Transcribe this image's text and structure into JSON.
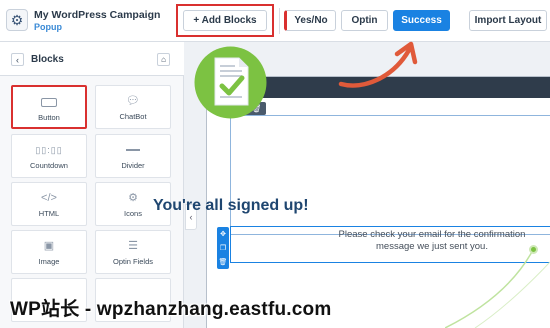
{
  "header": {
    "campaign_title": "My WordPress Campaign",
    "campaign_type": "Popup",
    "add_blocks_label": "+ Add Blocks",
    "tabs": [
      {
        "label": "Yes/No"
      },
      {
        "label": "Optin"
      },
      {
        "label": "Success",
        "active": true
      }
    ],
    "import_layout_label": "Import Layout",
    "accent_color": "#1a82e2",
    "highlight_color": "#d9302f"
  },
  "sidebar": {
    "title": "Blocks",
    "back_icon": "chevron-left-icon",
    "home_icon": "home-icon",
    "blocks": [
      {
        "label": "Button",
        "icon": "button-icon"
      },
      {
        "label": "ChatBot",
        "icon": "chat-icon"
      },
      {
        "label": "Countdown",
        "icon": "countdown-icon"
      },
      {
        "label": "Divider",
        "icon": "divider-icon"
      },
      {
        "label": "HTML",
        "icon": "code-icon"
      },
      {
        "label": "Icons",
        "icon": "gear-icon"
      },
      {
        "label": "Image",
        "icon": "image-icon"
      },
      {
        "label": "Optin Fields",
        "icon": "list-icon"
      }
    ]
  },
  "preview": {
    "heading": "You're all signed up!",
    "paragraph": "Please check your email for the confirmation message we just sent you.",
    "heading_color": "#1f4670",
    "icon_green": "#7cc242"
  },
  "watermark": "WP站长 - wpzhanzhang.eastfu.com"
}
